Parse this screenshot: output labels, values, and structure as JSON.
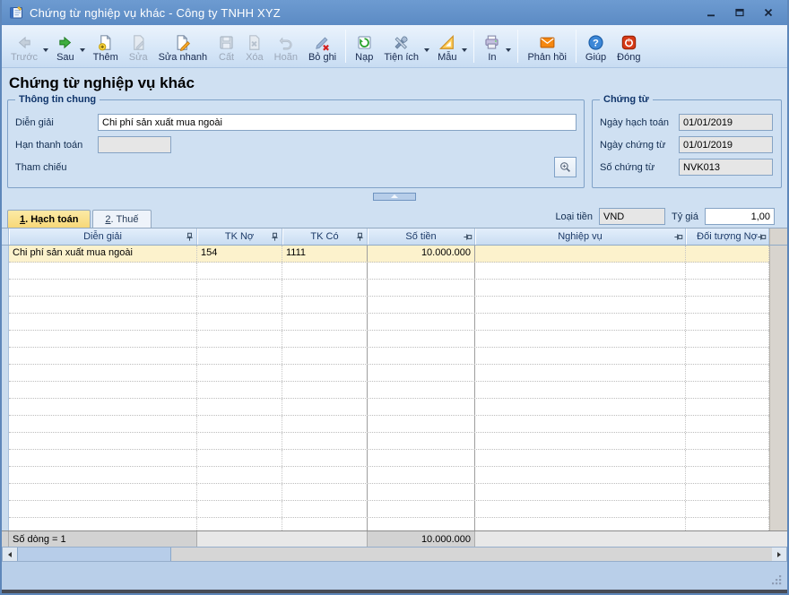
{
  "window": {
    "title": "Chứng từ nghiệp vụ khác - Công ty TNHH XYZ",
    "controls": [
      {
        "name": "minimize",
        "icon": "minimize-icon"
      },
      {
        "name": "maximize",
        "icon": "maximize-icon"
      },
      {
        "name": "close",
        "icon": "close-icon"
      }
    ]
  },
  "toolbar": {
    "items": [
      {
        "name": "prev",
        "label": "Trước",
        "icon": "arrow-left-icon",
        "enabled": false,
        "dropdown": true,
        "separator_after": false
      },
      {
        "name": "next",
        "label": "Sau",
        "icon": "arrow-right-icon",
        "enabled": true,
        "dropdown": true,
        "separator_after": false
      },
      {
        "name": "add",
        "label": "Thêm",
        "icon": "doc-add-icon",
        "enabled": true,
        "dropdown": false,
        "separator_after": false
      },
      {
        "name": "edit",
        "label": "Sửa",
        "icon": "doc-edit-icon",
        "enabled": false,
        "dropdown": false,
        "separator_after": false
      },
      {
        "name": "quick-edit",
        "label": "Sửa nhanh",
        "icon": "doc-pencil-icon",
        "enabled": true,
        "dropdown": false,
        "separator_after": false
      },
      {
        "name": "save",
        "label": "Cất",
        "icon": "floppy-icon",
        "enabled": false,
        "dropdown": false,
        "separator_after": false
      },
      {
        "name": "delete",
        "label": "Xóa",
        "icon": "doc-delete-icon",
        "enabled": false,
        "dropdown": false,
        "separator_after": false
      },
      {
        "name": "undo",
        "label": "Hoãn",
        "icon": "undo-icon",
        "enabled": false,
        "dropdown": false,
        "separator_after": false
      },
      {
        "name": "unpost",
        "label": "Bỏ ghi",
        "icon": "pencil-cross-icon",
        "enabled": true,
        "dropdown": false,
        "separator_after": true
      },
      {
        "name": "reload",
        "label": "Nạp",
        "icon": "refresh-icon",
        "enabled": true,
        "dropdown": false,
        "separator_after": false
      },
      {
        "name": "utilities",
        "label": "Tiện ích",
        "icon": "tools-icon",
        "enabled": true,
        "dropdown": true,
        "separator_after": false
      },
      {
        "name": "template",
        "label": "Mẫu",
        "icon": "set-square-icon",
        "enabled": true,
        "dropdown": true,
        "separator_after": true
      },
      {
        "name": "print",
        "label": "In",
        "icon": "printer-icon",
        "enabled": true,
        "dropdown": true,
        "separator_after": true
      },
      {
        "name": "feedback",
        "label": "Phản hồi",
        "icon": "envelope-icon",
        "enabled": true,
        "dropdown": false,
        "separator_after": true
      },
      {
        "name": "help",
        "label": "Giúp",
        "icon": "question-icon",
        "enabled": true,
        "dropdown": false,
        "separator_after": false
      },
      {
        "name": "close-window",
        "label": "Đóng",
        "icon": "power-icon",
        "enabled": true,
        "dropdown": false,
        "separator_after": false
      }
    ]
  },
  "page": {
    "title": "Chứng từ nghiệp vụ khác"
  },
  "general_info": {
    "legend": "Thông tin chung",
    "dien_giai": {
      "label": "Diễn giải",
      "value": "Chi phí sản xuất mua ngoài"
    },
    "han_thanh_toan": {
      "label": "Hạn thanh toán",
      "value": ""
    },
    "tham_chieu": {
      "label": "Tham chiếu",
      "button_icon": "magnifier-plus-icon"
    }
  },
  "document_info": {
    "legend": "Chứng từ",
    "ngay_hach_toan": {
      "label": "Ngày hạch toán",
      "value": "01/01/2019"
    },
    "ngay_chung_tu": {
      "label": "Ngày chứng từ",
      "value": "01/01/2019"
    },
    "so_chung_tu": {
      "label": "Số chứng từ",
      "value": "NVK013"
    }
  },
  "tabs": [
    {
      "num": "1",
      "rest": ". Hạch toán",
      "active": true
    },
    {
      "num": "2",
      "rest": ". Thuế",
      "active": false
    }
  ],
  "currency": {
    "loai_tien_label": "Loại tiền",
    "loai_tien_value": "VND",
    "ty_gia_label": "Tỷ giá",
    "ty_gia_value": "1,00"
  },
  "table": {
    "columns": [
      {
        "label": "Diễn giải",
        "pinned": true
      },
      {
        "label": "TK Nợ",
        "pinned": true
      },
      {
        "label": "TK Có",
        "pinned": true
      },
      {
        "label": "Số tiền",
        "pinned": false
      },
      {
        "label": "Nghiệp vụ",
        "pinned": false
      },
      {
        "label": "Đối tượng Nợ",
        "pinned": false
      }
    ],
    "rows": [
      [
        "Chi phí sản xuất mua ngoài",
        "154",
        "1111",
        "10.000.000",
        "",
        ""
      ]
    ],
    "footer": {
      "rows_label": "Số dòng = 1",
      "sum": "10.000.000"
    }
  },
  "colors": {
    "titlebar": "#6191c8",
    "selected_row": "#fcf2cc",
    "active_tab": "#f8db7e",
    "group_border": "#7fa1c7"
  }
}
